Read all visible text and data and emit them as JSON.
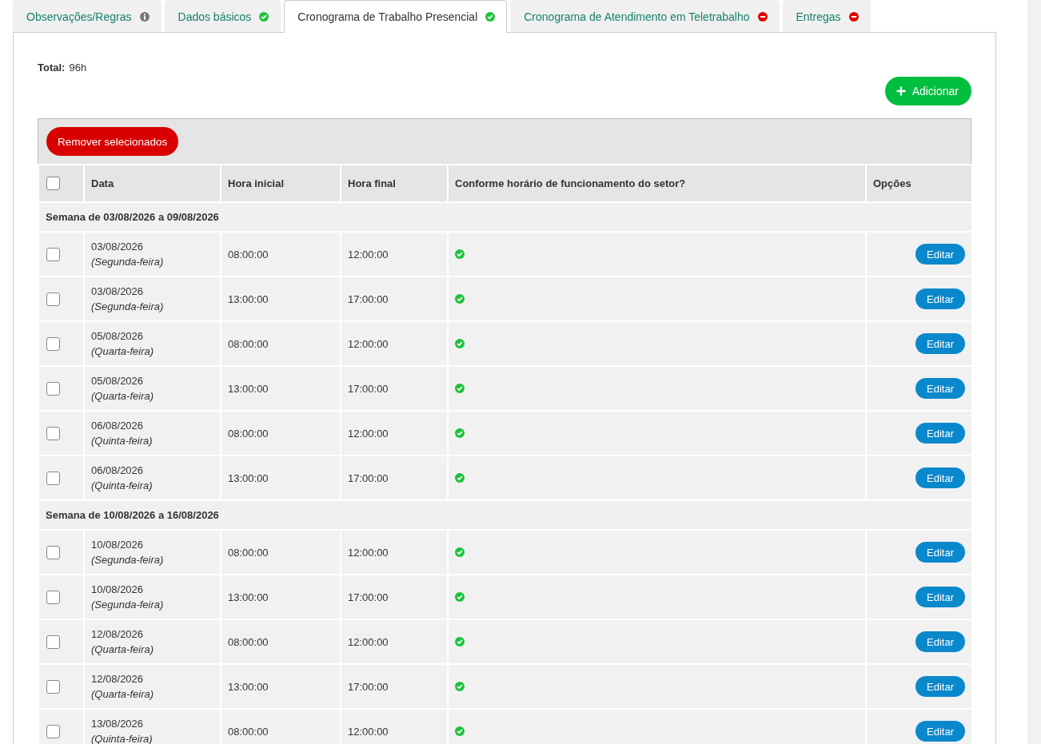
{
  "tabs": [
    {
      "label": "Observações/Regras",
      "kind": "info",
      "selected": false
    },
    {
      "label": "Dados básicos",
      "kind": "ok",
      "selected": false
    },
    {
      "label": "Cronograma de Trabalho Presencial",
      "kind": "ok",
      "selected": true
    },
    {
      "label": "Cronograma de Atendimento em Teletrabalho",
      "kind": "error",
      "selected": false
    },
    {
      "label": "Entregas",
      "kind": "error",
      "selected": false
    }
  ],
  "summary": {
    "label": "Total:",
    "value": "96h"
  },
  "add_button": {
    "label": "Adicionar"
  },
  "remove_button": {
    "label": "Remover selecionados"
  },
  "table": {
    "select_all": {
      "checked": false
    },
    "columns": [
      "Data",
      "Hora inicial",
      "Hora final",
      "Conforme horário de funcionamento do setor?",
      "Opções"
    ],
    "groups": [
      {
        "title": "Semana de 03/08/2026 a 09/08/2026",
        "rows": [
          {
            "checked": false,
            "date": "03/08/2026",
            "weekday": "(Segunda-feira)",
            "start": "08:00:00",
            "end": "12:00:00",
            "compliant": true,
            "action": "Editar"
          },
          {
            "checked": false,
            "date": "03/08/2026",
            "weekday": "(Segunda-feira)",
            "start": "13:00:00",
            "end": "17:00:00",
            "compliant": true,
            "action": "Editar"
          },
          {
            "checked": false,
            "date": "05/08/2026",
            "weekday": "(Quarta-feira)",
            "start": "08:00:00",
            "end": "12:00:00",
            "compliant": true,
            "action": "Editar"
          },
          {
            "checked": false,
            "date": "05/08/2026",
            "weekday": "(Quarta-feira)",
            "start": "13:00:00",
            "end": "17:00:00",
            "compliant": true,
            "action": "Editar"
          },
          {
            "checked": false,
            "date": "06/08/2026",
            "weekday": "(Quinta-feira)",
            "start": "08:00:00",
            "end": "12:00:00",
            "compliant": true,
            "action": "Editar"
          },
          {
            "checked": false,
            "date": "06/08/2026",
            "weekday": "(Quinta-feira)",
            "start": "13:00:00",
            "end": "17:00:00",
            "compliant": true,
            "action": "Editar"
          }
        ]
      },
      {
        "title": "Semana de 10/08/2026 a 16/08/2026",
        "rows": [
          {
            "checked": false,
            "date": "10/08/2026",
            "weekday": "(Segunda-feira)",
            "start": "08:00:00",
            "end": "12:00:00",
            "compliant": true,
            "action": "Editar"
          },
          {
            "checked": false,
            "date": "10/08/2026",
            "weekday": "(Segunda-feira)",
            "start": "13:00:00",
            "end": "17:00:00",
            "compliant": true,
            "action": "Editar"
          },
          {
            "checked": false,
            "date": "12/08/2026",
            "weekday": "(Quarta-feira)",
            "start": "08:00:00",
            "end": "12:00:00",
            "compliant": true,
            "action": "Editar"
          },
          {
            "checked": false,
            "date": "12/08/2026",
            "weekday": "(Quarta-feira)",
            "start": "13:00:00",
            "end": "17:00:00",
            "compliant": true,
            "action": "Editar"
          },
          {
            "checked": false,
            "date": "13/08/2026",
            "weekday": "(Quinta-feira)",
            "start": "08:00:00",
            "end": "12:00:00",
            "compliant": true,
            "action": "Editar"
          }
        ]
      }
    ]
  }
}
